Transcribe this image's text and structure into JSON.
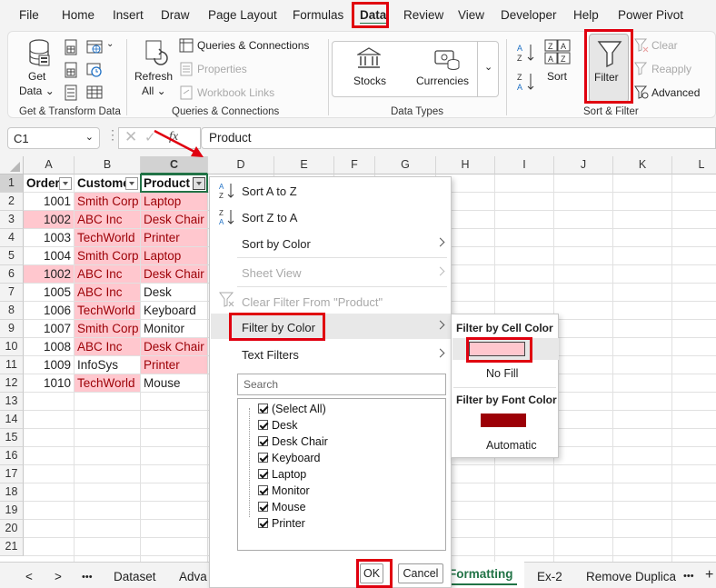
{
  "menu": {
    "items": [
      "File",
      "Home",
      "Insert",
      "Draw",
      "Page Layout",
      "Formulas",
      "Data",
      "Review",
      "View",
      "Developer",
      "Help",
      "Power Pivot"
    ],
    "active": "Data"
  },
  "ribbon": {
    "get_data": "Get",
    "get_data_line2": "Data",
    "refresh": "Refresh",
    "refresh_line2": "All",
    "queries_connections": "Queries & Connections",
    "properties": "Properties",
    "workbook_links": "Workbook Links",
    "stocks": "Stocks",
    "currencies": "Currencies",
    "sort": "Sort",
    "filter": "Filter",
    "clear": "Clear",
    "reapply": "Reapply",
    "advanced": "Advanced",
    "group_get_transform": "Get & Transform Data",
    "group_queries": "Queries & Connections",
    "group_data_types": "Data Types",
    "group_sort_filter": "Sort & Filter"
  },
  "formula_bar": {
    "name_box": "C1",
    "fx": "fx",
    "value": "Product"
  },
  "grid": {
    "columns": [
      "A",
      "B",
      "C",
      "D",
      "E",
      "F",
      "G",
      "H",
      "I",
      "J",
      "K",
      "L"
    ],
    "rows": [
      "1",
      "2",
      "3",
      "4",
      "5",
      "6",
      "7",
      "8",
      "9",
      "10",
      "11",
      "12",
      "13",
      "14",
      "15",
      "16",
      "17",
      "18",
      "19",
      "20",
      "21"
    ],
    "headers": [
      "Order",
      "Custome",
      "Product"
    ],
    "data": [
      [
        "1001",
        "Smith Corp",
        "Laptop"
      ],
      [
        "1002",
        "ABC Inc",
        "Desk Chair"
      ],
      [
        "1003",
        "TechWorld",
        "Printer"
      ],
      [
        "1004",
        "Smith Corp",
        "Laptop"
      ],
      [
        "1002",
        "ABC Inc",
        "Desk Chair"
      ],
      [
        "1005",
        "ABC Inc",
        "Desk"
      ],
      [
        "1006",
        "TechWorld",
        "Keyboard"
      ],
      [
        "1007",
        "Smith Corp",
        "Monitor"
      ],
      [
        "1008",
        "ABC Inc",
        "Desk Chair"
      ],
      [
        "1009",
        "InfoSys",
        "Printer"
      ],
      [
        "1010",
        "TechWorld",
        "Mouse"
      ]
    ],
    "highlight_color": "#ffc7ce",
    "highlight_text_color": "#9c0006"
  },
  "dropdown": {
    "sort_az": "Sort A to Z",
    "sort_za": "Sort Z to A",
    "sort_by_color": "Sort by Color",
    "sheet_view": "Sheet View",
    "clear_filter": "Clear Filter From \"Product\"",
    "filter_by_color": "Filter by Color",
    "text_filters": "Text Filters",
    "search_placeholder": "Search",
    "checklist": [
      "(Select All)",
      "Desk",
      "Desk Chair",
      "Keyboard",
      "Laptop",
      "Monitor",
      "Mouse",
      "Printer"
    ],
    "ok": "OK",
    "cancel": "Cancel"
  },
  "submenu": {
    "cell_color_title": "Filter by Cell Color",
    "cell_color_swatch": "#ffc7ce",
    "no_fill": "No Fill",
    "font_color_title": "Filter by Font Color",
    "font_color_swatch": "#9c0006",
    "automatic": "Automatic"
  },
  "tabs": {
    "nav_prev": "<",
    "nav_next": ">",
    "more": "•••",
    "items": [
      "Dataset",
      "Adva",
      "Formatting",
      "Ex-2",
      "Remove Duplica"
    ],
    "active": "Formatting",
    "add": "+"
  },
  "accent_color": "#e0000f"
}
